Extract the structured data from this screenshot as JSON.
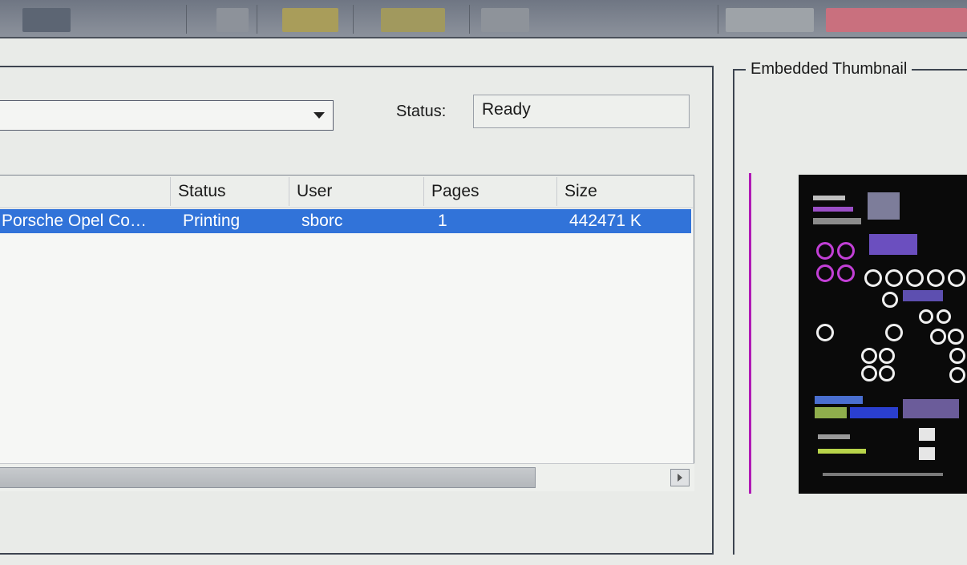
{
  "jobs_panel": {
    "status_label": "Status:",
    "status_value": "Ready",
    "columns": [
      "Status",
      "User",
      "Pages",
      "Size"
    ],
    "rows": [
      {
        "name": "Porsche Opel Co…",
        "status": "Printing",
        "user": "sborc",
        "pages": "1",
        "size": "442471 K"
      }
    ]
  },
  "thumbnail_panel": {
    "title": "Embedded Thumbnail"
  },
  "colors": {
    "selection": "#3173d9",
    "accent_line": "#b01ab5",
    "frame": "#3d4450"
  },
  "icons": [
    "dropdown-arrow-icon",
    "scroll-right-arrow-icon"
  ]
}
